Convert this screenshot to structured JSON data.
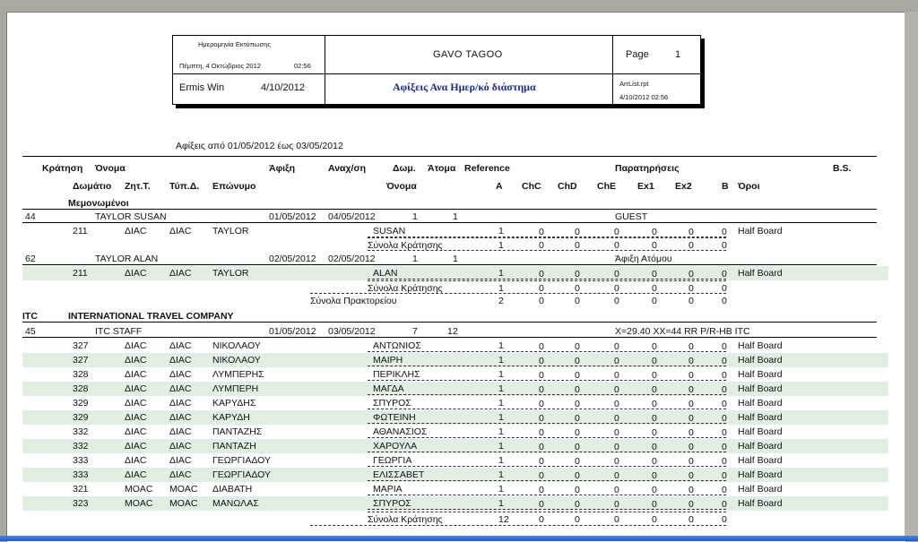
{
  "header": {
    "print_date_label": "Ημερομηνία Εκτύπωσης",
    "print_date": "Πέμπτη, 4 Οκτώβριος 2012",
    "print_time": "02:56",
    "app_name": "Ermis Win",
    "app_date": "4/10/2012",
    "company": "GAVO TAGOO",
    "report_title": "Αφίξεις Ανα Ημερ/κό διάστημα",
    "page_label": "Page",
    "page_number": "1",
    "report_file": "ArrList.rpt",
    "report_file_date": "4/10/2012  02:56"
  },
  "period": "Αφίξεις από 01/05/2012 έως 03/05/2012",
  "columns": {
    "row1": [
      "Κράτηση",
      "Όνομα",
      "Άφιξη",
      "Αναχ/ση",
      "Δωμ.",
      "Άτομα",
      "Reference",
      "Παρατηρήσεις",
      "B.S."
    ],
    "row2": [
      "Δωμάτιο",
      "Ζητ.Τ.",
      "Τύπ.Δ.",
      "Επώνυμο",
      "Όνομα",
      "A",
      "ChC",
      "ChD",
      "ChE",
      "Ex1",
      "Ex2",
      "B",
      "Όροι"
    ]
  },
  "group1": {
    "code": "",
    "name": "Μεμονωμένοι"
  },
  "res1": {
    "no": "44",
    "name": "TAYLOR SUSAN",
    "arr": "01/05/2012",
    "dep": "04/05/2012",
    "rooms": "1",
    "persons": "1",
    "remark": "GUEST"
  },
  "res2": {
    "no": "62",
    "name": "TAYLOR ALAN",
    "arr": "02/05/2012",
    "dep": "02/05/2012",
    "rooms": "1",
    "persons": "1",
    "remark": "Άφιξη Ατόμου"
  },
  "res3": {
    "no": "45",
    "name": "ITC STAFF",
    "arr": "01/05/2012",
    "dep": "03/05/2012",
    "rooms": "7",
    "persons": "12",
    "remark": "X=29.40 XX=44 RR P/R-HB ITC"
  },
  "group2": {
    "code": "ITC",
    "name": "INTERNATIONAL TRAVEL COMPANY"
  },
  "labels": {
    "res_totals": "Σύνολα Κράτησης",
    "agency_totals": "Σύνολα Πρακτορείου"
  },
  "rows": [
    {
      "room": "211",
      "req": "ΔΙΑC",
      "type": "ΔΙΑC",
      "surname": "TAYLOR",
      "first": "SUSAN",
      "a": "1",
      "chc": "0",
      "chd": "0",
      "che": "0",
      "ex1": "0",
      "ex2": "0",
      "b": "0",
      "terms": "Half Board",
      "band": false
    },
    {
      "room": "211",
      "req": "ΔΙΑC",
      "type": "ΔΙΑC",
      "surname": "TAYLOR",
      "first": "ALAN",
      "a": "1",
      "chc": "0",
      "chd": "0",
      "che": "0",
      "ex1": "0",
      "ex2": "0",
      "b": "0",
      "terms": "Half Board",
      "band": true
    },
    {
      "room": "327",
      "req": "ΔΙΑC",
      "type": "ΔΙΑC",
      "surname": "ΝΙΚΟΛΑΟΥ",
      "first": "ΑΝΤΩΝΙΟΣ",
      "a": "1",
      "chc": "0",
      "chd": "0",
      "che": "0",
      "ex1": "0",
      "ex2": "0",
      "b": "0",
      "terms": "Half Board",
      "band": false
    },
    {
      "room": "327",
      "req": "ΔΙΑC",
      "type": "ΔΙΑC",
      "surname": "ΝΙΚΟΛΑΟΥ",
      "first": "ΜΑΙΡΗ",
      "a": "1",
      "chc": "0",
      "chd": "0",
      "che": "0",
      "ex1": "0",
      "ex2": "0",
      "b": "0",
      "terms": "Half Board",
      "band": true
    },
    {
      "room": "328",
      "req": "ΔΙΑC",
      "type": "ΔΙΑC",
      "surname": "ΛΥΜΠΕΡΗΣ",
      "first": "ΠΕΡΙΚΛΗΣ",
      "a": "1",
      "chc": "0",
      "chd": "0",
      "che": "0",
      "ex1": "0",
      "ex2": "0",
      "b": "0",
      "terms": "Half Board",
      "band": false
    },
    {
      "room": "328",
      "req": "ΔΙΑC",
      "type": "ΔΙΑC",
      "surname": "ΛΥΜΠΕΡΗ",
      "first": "ΜΑΓΔΑ",
      "a": "1",
      "chc": "0",
      "chd": "0",
      "che": "0",
      "ex1": "0",
      "ex2": "0",
      "b": "0",
      "terms": "Half Board",
      "band": true
    },
    {
      "room": "329",
      "req": "ΔΙΑC",
      "type": "ΔΙΑC",
      "surname": "ΚΑΡΥΔΗΣ",
      "first": "ΣΠΥΡΟΣ",
      "a": "1",
      "chc": "0",
      "chd": "0",
      "che": "0",
      "ex1": "0",
      "ex2": "0",
      "b": "0",
      "terms": "Half Board",
      "band": false
    },
    {
      "room": "329",
      "req": "ΔΙΑC",
      "type": "ΔΙΑC",
      "surname": "ΚΑΡΥΔΗ",
      "first": "ΦΩΤΕΙΝΗ",
      "a": "1",
      "chc": "0",
      "chd": "0",
      "che": "0",
      "ex1": "0",
      "ex2": "0",
      "b": "0",
      "terms": "Half Board",
      "band": true
    },
    {
      "room": "332",
      "req": "ΔΙΑC",
      "type": "ΔΙΑC",
      "surname": "ΠΑΝΤΑΖΗΣ",
      "first": "ΑΘΑΝΑΣΙΟΣ",
      "a": "1",
      "chc": "0",
      "chd": "0",
      "che": "0",
      "ex1": "0",
      "ex2": "0",
      "b": "0",
      "terms": "Half Board",
      "band": false
    },
    {
      "room": "332",
      "req": "ΔΙΑC",
      "type": "ΔΙΑC",
      "surname": "ΠΑΝΤΑΖΗ",
      "first": "ΧΑΡΟΥΛΑ",
      "a": "1",
      "chc": "0",
      "chd": "0",
      "che": "0",
      "ex1": "0",
      "ex2": "0",
      "b": "0",
      "terms": "Half Board",
      "band": true
    },
    {
      "room": "333",
      "req": "ΔΙΑC",
      "type": "ΔΙΑC",
      "surname": "ΓΕΩΡΓΙΑΔΟΥ",
      "first": "ΓΕΩΡΓΙΑ",
      "a": "1",
      "chc": "0",
      "chd": "0",
      "che": "0",
      "ex1": "0",
      "ex2": "0",
      "b": "0",
      "terms": "Half Board",
      "band": false
    },
    {
      "room": "333",
      "req": "ΔΙΑC",
      "type": "ΔΙΑC",
      "surname": "ΓΕΩΡΓΙΑΔΟΥ",
      "first": "ΕΛΙΣΣΑΒΕΤ",
      "a": "1",
      "chc": "0",
      "chd": "0",
      "che": "0",
      "ex1": "0",
      "ex2": "0",
      "b": "0",
      "terms": "Half Board",
      "band": true
    },
    {
      "room": "321",
      "req": "MOAC",
      "type": "MOAC",
      "surname": "ΔΙΑΒΑΤΗ",
      "first": "ΜΑΡΙΑ",
      "a": "1",
      "chc": "0",
      "chd": "0",
      "che": "0",
      "ex1": "0",
      "ex2": "0",
      "b": "0",
      "terms": "Half Board",
      "band": false
    },
    {
      "room": "323",
      "req": "MOAC",
      "type": "MOAC",
      "surname": "ΜΑΝΩΛΑΣ",
      "first": "ΣΠΥΡΟΣ",
      "a": "1",
      "chc": "0",
      "chd": "0",
      "che": "0",
      "ex1": "0",
      "ex2": "0",
      "b": "0",
      "terms": "Half Board",
      "band": true
    }
  ],
  "totals": {
    "res1": {
      "a": "1",
      "chc": "0",
      "chd": "0",
      "che": "0",
      "ex1": "0",
      "ex2": "0",
      "b": "0"
    },
    "res2": {
      "a": "1",
      "chc": "0",
      "chd": "0",
      "che": "0",
      "ex1": "0",
      "ex2": "0",
      "b": "0"
    },
    "agency1": {
      "a": "2",
      "chc": "0",
      "chd": "0",
      "che": "0",
      "ex1": "0",
      "ex2": "0",
      "b": "0"
    },
    "res3": {
      "a": "12",
      "chc": "0",
      "chd": "0",
      "che": "0",
      "ex1": "0",
      "ex2": "0",
      "b": "0"
    }
  }
}
